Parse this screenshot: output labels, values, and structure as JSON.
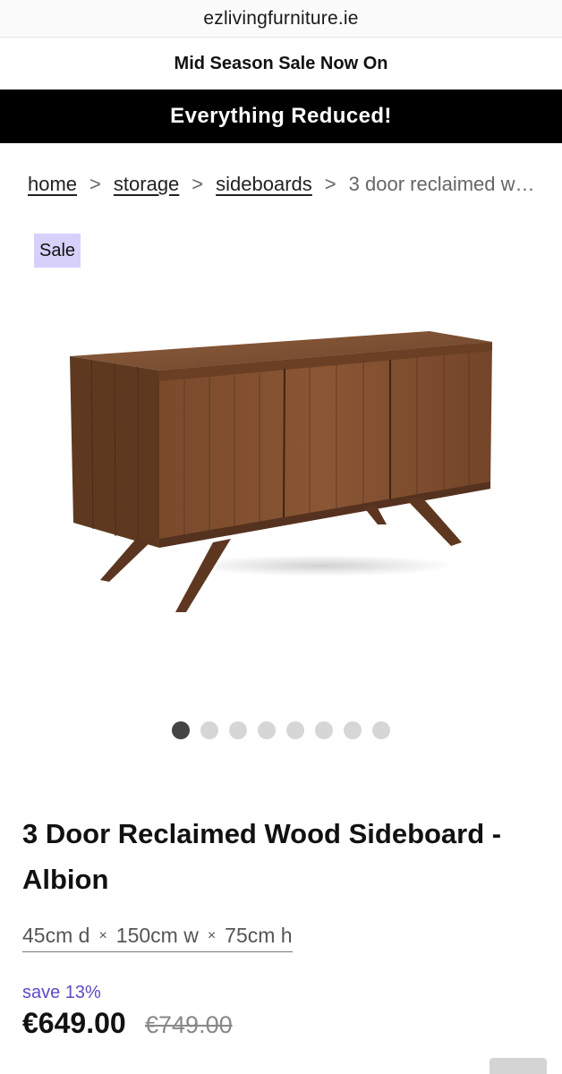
{
  "browser": {
    "url": "ezlivingfurniture.ie"
  },
  "promo": {
    "line1": "Mid Season Sale Now On",
    "line2": "Everything Reduced!"
  },
  "breadcrumb": {
    "items": [
      "home",
      "storage",
      "sideboards"
    ],
    "separator": ">",
    "current": "3 door reclaimed wood sideboard - albion"
  },
  "badge": {
    "label": "Sale",
    "color": "#d6d0fb"
  },
  "gallery": {
    "image_count": 8,
    "active_index": 0
  },
  "product": {
    "title": "3 Door Reclaimed Wood Sideboard - Albion",
    "dimensions": {
      "depth": "45cm d",
      "width": "150cm w",
      "height": "75cm h",
      "separator": "×"
    },
    "save_text": "save 13%",
    "price": "€649.00",
    "was_price": "€749.00"
  },
  "colors": {
    "promo_bar": "#000000",
    "save_accent": "#5b4bc4",
    "badge_bg": "#d6d0fb"
  }
}
